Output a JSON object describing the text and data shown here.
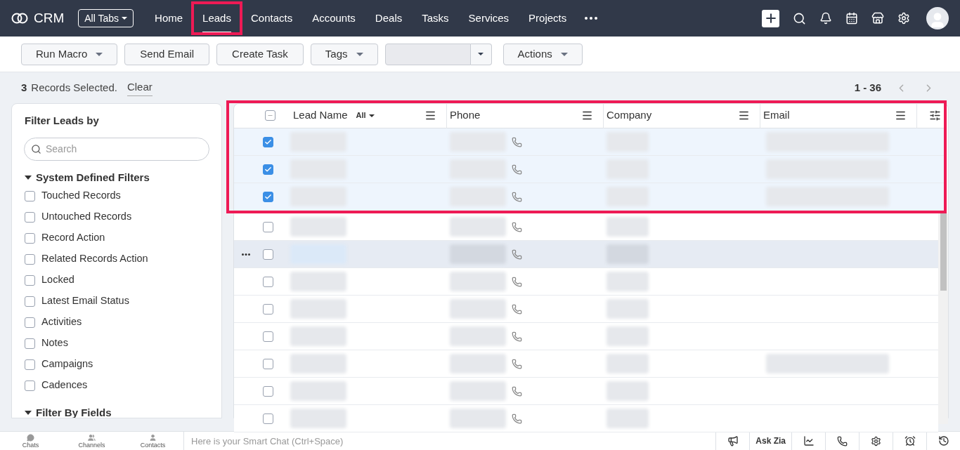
{
  "nav": {
    "logo": "CRM",
    "all_tabs": "All Tabs",
    "tabs": [
      {
        "label": "Home",
        "selected": false,
        "highlighted": false
      },
      {
        "label": "Leads",
        "selected": true,
        "highlighted": true
      },
      {
        "label": "Contacts",
        "selected": false,
        "highlighted": false
      },
      {
        "label": "Accounts",
        "selected": false,
        "highlighted": false
      },
      {
        "label": "Deals",
        "selected": false,
        "highlighted": false
      },
      {
        "label": "Tasks",
        "selected": false,
        "highlighted": false
      },
      {
        "label": "Services",
        "selected": false,
        "highlighted": false
      },
      {
        "label": "Projects",
        "selected": false,
        "highlighted": false
      }
    ]
  },
  "toolbar": {
    "buttons": [
      {
        "label": "Run Macro",
        "kind": "dropdown"
      },
      {
        "label": "Send Email",
        "kind": "plain"
      },
      {
        "label": "Create Task",
        "kind": "plain"
      },
      {
        "label": "Tags",
        "kind": "dropdown"
      },
      {
        "kind": "split"
      },
      {
        "label": "Actions",
        "kind": "dropdown"
      }
    ]
  },
  "selection": {
    "count": "3",
    "text": "Records Selected.",
    "clear": "Clear",
    "range": "1 - 36"
  },
  "filters": {
    "title": "Filter Leads by",
    "search_placeholder": "Search",
    "sections": [
      {
        "title": "System Defined Filters",
        "expanded": true,
        "items": [
          {
            "label": "Touched Records",
            "checked": false
          },
          {
            "label": "Untouched Records",
            "checked": false
          },
          {
            "label": "Record Action",
            "checked": false
          },
          {
            "label": "Related Records Action",
            "checked": false
          },
          {
            "label": "Locked",
            "checked": false
          },
          {
            "label": "Latest Email Status",
            "checked": false
          },
          {
            "label": "Activities",
            "checked": false
          },
          {
            "label": "Notes",
            "checked": false
          },
          {
            "label": "Campaigns",
            "checked": false
          },
          {
            "label": "Cadences",
            "checked": false
          }
        ]
      },
      {
        "title": "Filter By Fields",
        "expanded": true
      }
    ]
  },
  "table": {
    "columns": [
      {
        "label": "Lead Name",
        "filter": "All"
      },
      {
        "label": "Phone"
      },
      {
        "label": "Company"
      },
      {
        "label": "Email"
      }
    ],
    "selection_highlighted": true,
    "select_all_partial": true,
    "rows": [
      {
        "selected": true,
        "hovered": false,
        "has_email": true
      },
      {
        "selected": true,
        "hovered": false,
        "has_email": true
      },
      {
        "selected": true,
        "hovered": false,
        "has_email": true
      },
      {
        "selected": false,
        "hovered": false,
        "has_email": false
      },
      {
        "selected": false,
        "hovered": true,
        "has_email": false
      },
      {
        "selected": false,
        "hovered": false,
        "has_email": false
      },
      {
        "selected": false,
        "hovered": false,
        "has_email": false
      },
      {
        "selected": false,
        "hovered": false,
        "has_email": false
      },
      {
        "selected": false,
        "hovered": false,
        "has_email": true
      },
      {
        "selected": false,
        "hovered": false,
        "has_email": false
      },
      {
        "selected": false,
        "hovered": false,
        "has_email": false
      }
    ]
  },
  "bottom_bar": {
    "items": [
      "Chats",
      "Channels",
      "Contacts"
    ],
    "chat_placeholder": "Here is your Smart Chat (Ctrl+Space)",
    "ask_zia": "Ask Zia"
  }
}
